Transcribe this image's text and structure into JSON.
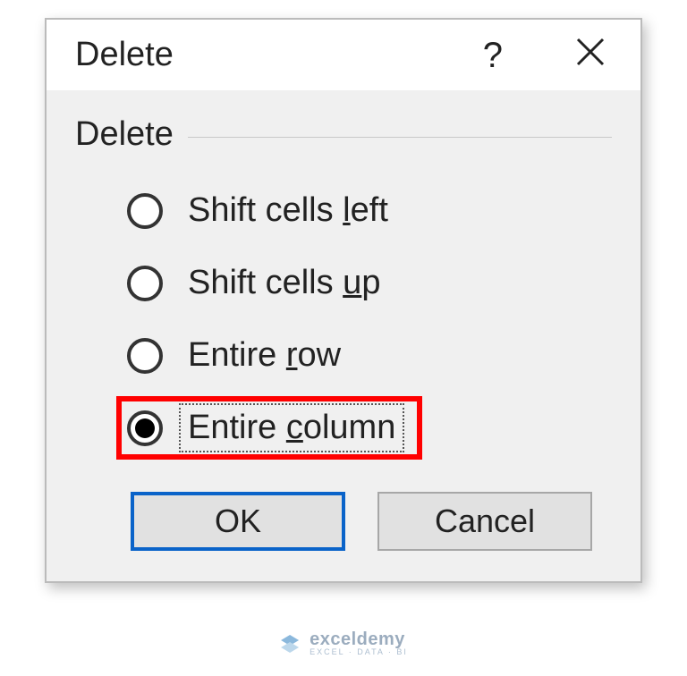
{
  "dialog": {
    "title": "Delete",
    "groupLabel": "Delete",
    "options": [
      {
        "pre": "Shift cells ",
        "accel": "l",
        "post": "eft",
        "selected": false,
        "highlight": false,
        "name": "radio-shift-cells-left"
      },
      {
        "pre": "Shift cells ",
        "accel": "u",
        "post": "p",
        "selected": false,
        "highlight": false,
        "name": "radio-shift-cells-up"
      },
      {
        "pre": "Entire ",
        "accel": "r",
        "post": "ow",
        "selected": false,
        "highlight": false,
        "name": "radio-entire-row"
      },
      {
        "pre": "Entire ",
        "accel": "c",
        "post": "olumn",
        "selected": true,
        "highlight": true,
        "name": "radio-entire-column"
      }
    ],
    "buttons": {
      "ok": "OK",
      "cancel": "Cancel"
    }
  },
  "watermark": {
    "main": "exceldemy",
    "sub": "EXCEL · DATA · BI"
  }
}
